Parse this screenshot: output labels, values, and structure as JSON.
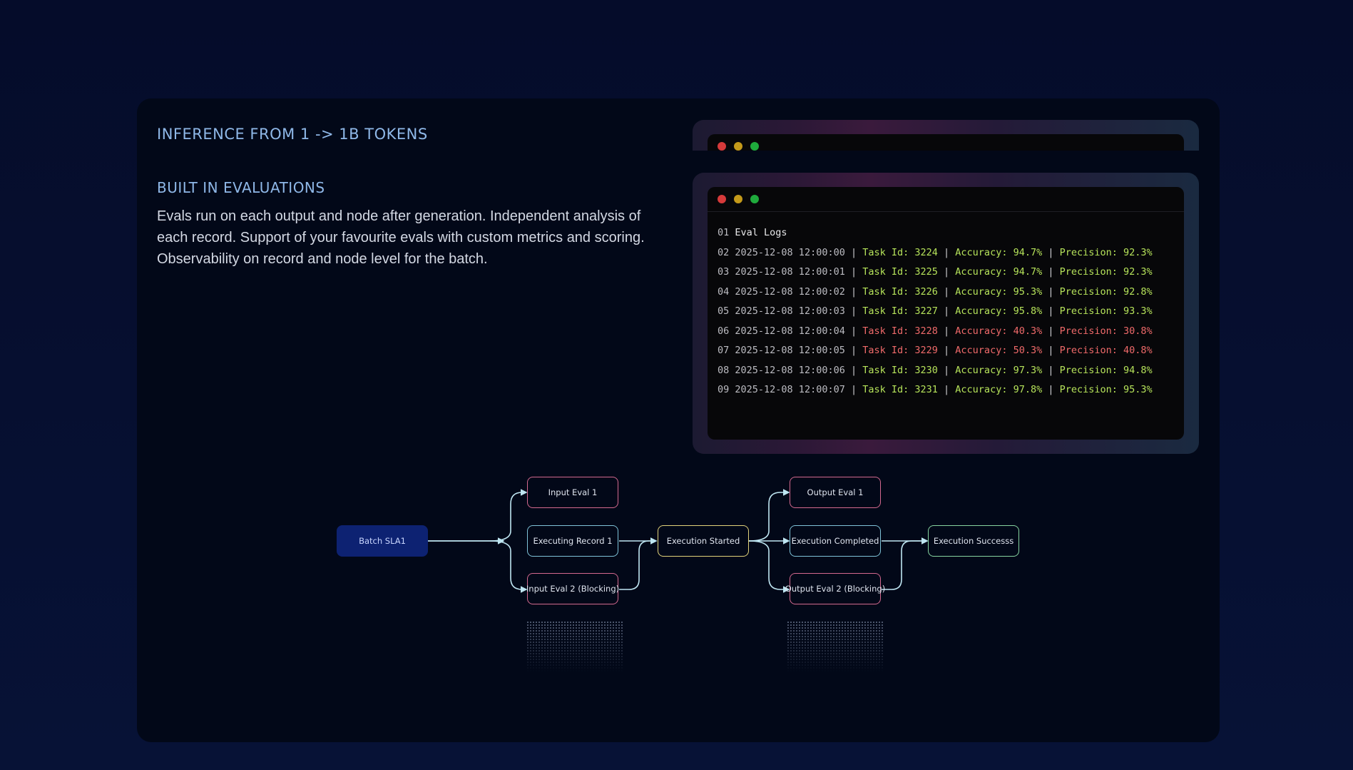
{
  "hero": {
    "eyebrow": "INFERENCE FROM 1 -> 1B TOKENS",
    "section_title": "BUILT IN EVALUATIONS",
    "description": "Evals run on each output and node after generation. Independent analysis of each record. Support of your favourite evals with custom metrics and scoring. Observability on record and node level for the batch."
  },
  "terminal": {
    "header_num": "01",
    "header_text": "Eval Logs",
    "rows": [
      {
        "num": "02",
        "timestamp": "2025-12-08 12:00:00",
        "task": "Task Id: 3224",
        "accuracy": "Accuracy: 94.7%",
        "precision": "Precision: 92.3%",
        "status": "ok"
      },
      {
        "num": "03",
        "timestamp": "2025-12-08 12:00:01",
        "task": "Task Id: 3225",
        "accuracy": "Accuracy: 94.7%",
        "precision": "Precision: 92.3%",
        "status": "ok"
      },
      {
        "num": "04",
        "timestamp": "2025-12-08 12:00:02",
        "task": "Task Id: 3226",
        "accuracy": "Accuracy: 95.3%",
        "precision": "Precision: 92.8%",
        "status": "ok"
      },
      {
        "num": "05",
        "timestamp": "2025-12-08 12:00:03",
        "task": "Task Id: 3227",
        "accuracy": "Accuracy: 95.8%",
        "precision": "Precision: 93.3%",
        "status": "ok"
      },
      {
        "num": "06",
        "timestamp": "2025-12-08 12:00:04",
        "task": "Task Id: 3228",
        "accuracy": "Accuracy: 40.3%",
        "precision": "Precision: 30.8%",
        "status": "bad"
      },
      {
        "num": "07",
        "timestamp": "2025-12-08 12:00:05",
        "task": "Task Id: 3229",
        "accuracy": "Accuracy: 50.3%",
        "precision": "Precision: 40.8%",
        "status": "bad"
      },
      {
        "num": "08",
        "timestamp": "2025-12-08 12:00:06",
        "task": "Task Id: 3230",
        "accuracy": "Accuracy: 97.3%",
        "precision": "Precision: 94.8%",
        "status": "ok"
      },
      {
        "num": "09",
        "timestamp": "2025-12-08 12:00:07",
        "task": "Task Id: 3231",
        "accuracy": "Accuracy: 97.8%",
        "precision": "Precision: 95.3%",
        "status": "ok"
      }
    ],
    "colors": {
      "ok": "#b6e35a",
      "bad": "#f06a6a",
      "dot_red": "#d63a3a",
      "dot_yellow": "#c49a1a",
      "dot_green": "#1faa3c"
    }
  },
  "flow": {
    "batch": "Batch SLA1",
    "input_eval_1": "Input Eval 1",
    "executing_record": "Executing Record 1",
    "input_eval_2": "Input Eval 2 (Blocking)",
    "execution_started": "Execution Started",
    "output_eval_1": "Output Eval 1",
    "execution_completed": "Execution Completed",
    "output_eval_2": "Output Eval 2 (Blocking)",
    "execution_success": "Execution Successs"
  }
}
